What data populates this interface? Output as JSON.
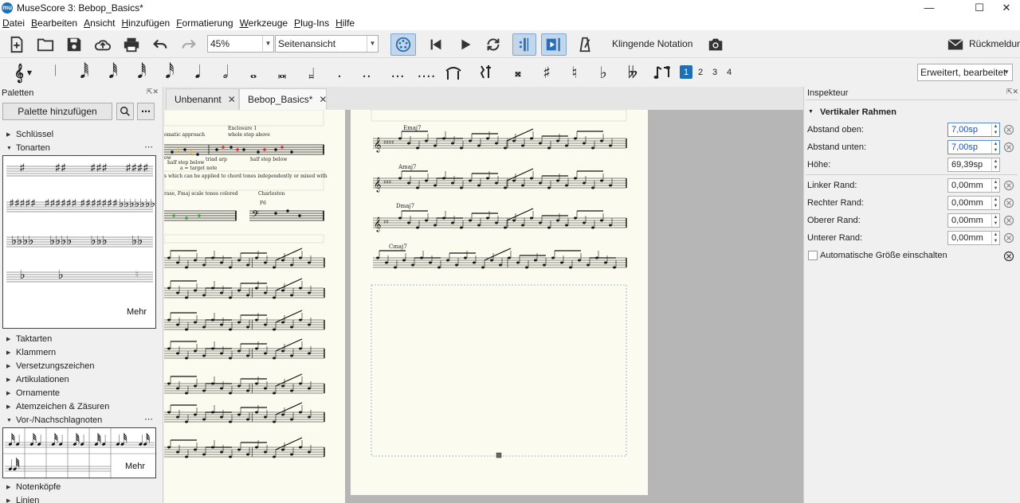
{
  "app": {
    "icon_text": "mu",
    "title": "MuseScore 3: Bebop_Basics*"
  },
  "menu": [
    {
      "label": "Datei",
      "u": "D",
      "rest": "atei"
    },
    {
      "label": "Bearbeiten",
      "u": "B",
      "rest": "earbeiten"
    },
    {
      "label": "Ansicht",
      "u": "A",
      "rest": "nsicht"
    },
    {
      "label": "Hinzufügen",
      "u": "H",
      "rest": "inzufügen"
    },
    {
      "label": "Formatierung",
      "u": "F",
      "rest": "ormatierung"
    },
    {
      "label": "Werkzeuge",
      "u": "W",
      "rest": "erkzeuge"
    },
    {
      "label": "Plug-Ins",
      "u": "P",
      "rest": "lug-Ins"
    },
    {
      "label": "Hilfe",
      "u": "H",
      "rest": "ilfe"
    }
  ],
  "toolbar": {
    "zoom": "45%",
    "view_mode": "Seitenansicht",
    "concert_pitch": "Klingende Notation",
    "feedback": "Rückmeldung"
  },
  "note_input": {
    "voices": [
      "1",
      "2",
      "3",
      "4"
    ],
    "workspace": "Erweitert, bearbeitet"
  },
  "palettes": {
    "title": "Paletten",
    "add_button": "Palette hinzufügen",
    "more_label": "Mehr",
    "items_top": [
      "Schlüssel",
      "Tonarten"
    ],
    "items_mid": [
      "Taktarten",
      "Klammern",
      "Versetzungszeichen",
      "Artikulationen",
      "Ornamente",
      "Atemzeichen & Zäsuren",
      "Vor-/Nachschlagnoten"
    ],
    "items_bottom": [
      "Notenköpfe",
      "Linien"
    ]
  },
  "tabs": [
    {
      "label": "Unbenannt"
    },
    {
      "label": "Bebop_Basics*"
    }
  ],
  "score": {
    "left_page": {
      "annot1": "Enclosure 1",
      "annot2": "whole step above",
      "annot3": "omatic approach",
      "annot4": "half step below",
      "annot5": "triad arp",
      "annot6": "half step below",
      "annot7": "a = target note",
      "annot8": "s which can be applied to chord tones independently or mixed with",
      "annot9": "rase, Fmaj scale tones colored",
      "annot10": "Charleston",
      "annot11": "F6",
      "annot12": "ow"
    },
    "right_page": {
      "chords": [
        "Emaj7",
        "Amaj7",
        "Dmaj7",
        "Cmaj7"
      ]
    }
  },
  "inspector": {
    "title": "Inspekteur",
    "section": "Vertikaler Rahmen",
    "fields": [
      {
        "label": "Abstand oben:",
        "value": "7,00sp"
      },
      {
        "label": "Abstand unten:",
        "value": "7,00sp"
      },
      {
        "label": "Höhe:",
        "value": "69,39sp"
      },
      {
        "label": "Linker Rand:",
        "value": "0,00mm"
      },
      {
        "label": "Rechter Rand:",
        "value": "0,00mm"
      },
      {
        "label": "Oberer Rand:",
        "value": "0,00mm"
      },
      {
        "label": "Unterer Rand:",
        "value": "0,00mm"
      }
    ],
    "checkbox": "Automatische Größe einschalten"
  }
}
